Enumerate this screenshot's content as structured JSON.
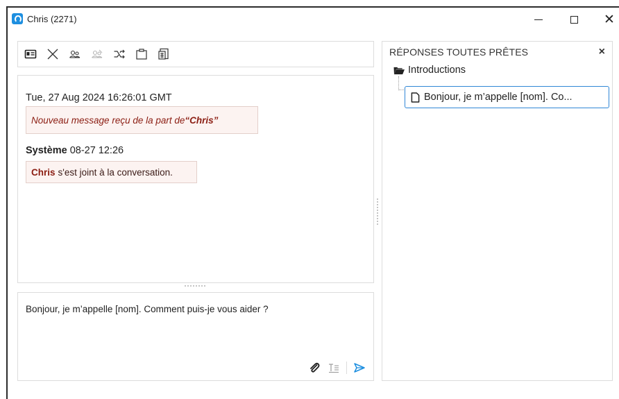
{
  "window": {
    "title": "Chris (2271)",
    "min_icon": "minimize-icon",
    "max_icon": "maximize-icon",
    "close_icon": "close-icon"
  },
  "toolbar": {
    "icons": [
      "contact-card-icon",
      "close-conversation-icon",
      "transfer-users-icon",
      "disabled-users-icon",
      "shuffle-icon",
      "clipboard-icon",
      "document-table-icon"
    ]
  },
  "conversation": {
    "date_line": "Tue, 27 Aug 2024 16:26:01 GMT",
    "notice_prefix": "Nouveau message reçu de la part de ",
    "notice_name": "“Chris”",
    "system_label": "Système",
    "system_time": "08-27 12:26",
    "join_name": "Chris",
    "join_text": "s'est joint à la conversation."
  },
  "compose": {
    "value": "Bonjour, je m’appelle [nom]. Comment puis-je vous aider ?",
    "attach_icon": "paperclip-icon",
    "format_icon": "text-format-icon",
    "send_icon": "send-icon"
  },
  "ready_answers": {
    "title": "RÉPONSES TOUTES PRÊTES",
    "close_symbol": "×",
    "folder_label": "Introductions",
    "item_label": "Bonjour, je m’appelle [nom]. Co..."
  },
  "colors": {
    "accent": "#2f86d6",
    "bubble_bg": "#fcf3f1",
    "bubble_text": "#8b1d12",
    "send": "#1e8fe0"
  }
}
